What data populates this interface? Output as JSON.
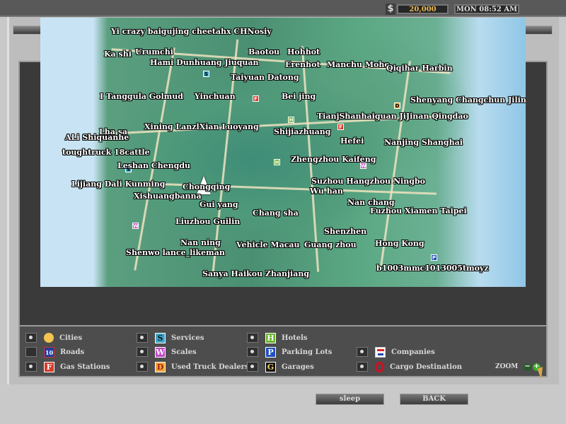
{
  "hud": {
    "currency_symbol": "$",
    "money": "20,000",
    "time": "MON 08:52 AM"
  },
  "map": {
    "labels": [
      "Yi crazy baigujing cheetahx CHNosiy",
      "Ka shi",
      "Urumchi",
      "Baotou",
      "Hohhot",
      "Hami Dunhuang Jiuquan",
      "Erenhot",
      "Manchu Mohe",
      "Qiqihar Harbin",
      "Taiyuan Datong",
      "I Tanggula Golmud",
      "Yinchuan",
      "Bei jing",
      "Shenyang Changchun Jilin",
      "TianjShanhaiguan JiJinan Qingdao",
      "Xining LanzlXian Luoyang",
      "Lha sa",
      "Shijiazhuang",
      "ALi Shiquanhe",
      "Hefei",
      "Nanjing Shanghai",
      "toughtruck 18cattle",
      "Zhengzhou Kaifeng",
      "Leshan Chengdu",
      "Suzhou Hangzhou Ningbo",
      "Lijiang Dali Kunming",
      "Chongqing",
      "Wu han",
      "Xishuangbanna",
      "Nan chang",
      "Gui yang",
      "Fuzhou Xiamen Taipei",
      "Chang sha",
      "Liuzhou Guilin",
      "Shenzhen",
      "Nan ning",
      "Vehicle Macau",
      "Guang zhou",
      "Hong Kong",
      "Shenwo lance_likeman",
      "b1003mmc1013005tmoyz",
      "Sanya Haikou Zhanjiang"
    ]
  },
  "legend": {
    "items": [
      {
        "label": "Cities",
        "icon": "city-dot",
        "checked": true
      },
      {
        "label": "Roads",
        "icon": "10",
        "checked": false
      },
      {
        "label": "Gas Stations",
        "icon": "F",
        "checked": true
      },
      {
        "label": "Services",
        "icon": "S",
        "checked": true
      },
      {
        "label": "Scales",
        "icon": "W",
        "checked": true
      },
      {
        "label": "Used Truck Dealers",
        "icon": "D",
        "checked": true
      },
      {
        "label": "Hotels",
        "icon": "H",
        "checked": true
      },
      {
        "label": "Parking Lots",
        "icon": "P",
        "checked": true
      },
      {
        "label": "Garages",
        "icon": "G",
        "checked": true
      },
      {
        "label": "Companies",
        "icon": "company-logo",
        "checked": true
      },
      {
        "label": "Cargo Destination",
        "icon": "ring",
        "checked": true
      }
    ],
    "zoom_label": "ZOOM",
    "zoom_out": "−",
    "zoom_in": "+"
  },
  "buttons": {
    "sleep": "sleep",
    "back": "BACK"
  },
  "colors": {
    "gas": "#d93a2a",
    "services": "#3fa7c9",
    "scales": "#c24ac6",
    "dealers": "#f0a535",
    "hotels": "#6bb42a",
    "parking": "#1f4fbf",
    "garages": "#111111",
    "cities": "#f3c450",
    "cargo": "#d01020"
  }
}
